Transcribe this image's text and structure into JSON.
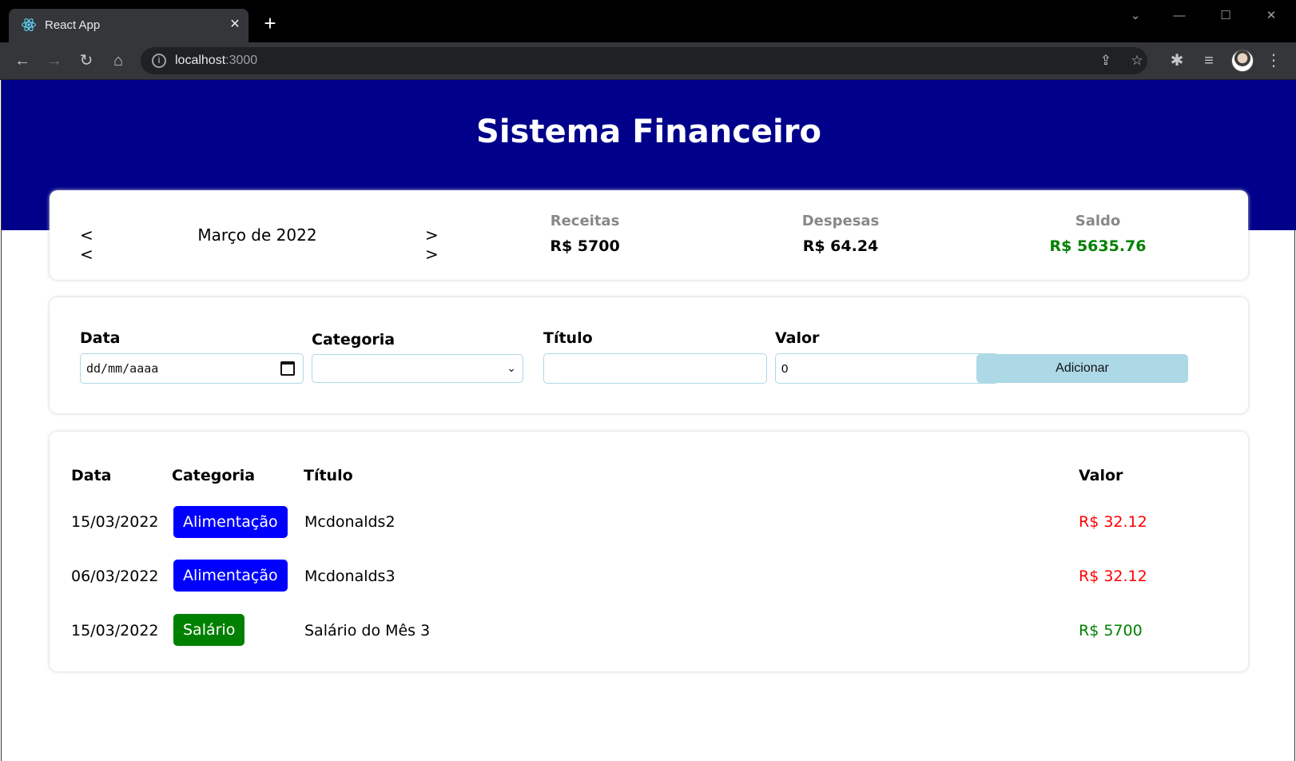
{
  "browser": {
    "tab_title": "React App",
    "url_host": "localhost",
    "url_port": ":3000"
  },
  "header": {
    "title": "Sistema Financeiro"
  },
  "info": {
    "prev_label": "< <",
    "month": "Março de 2022",
    "next_label": "> >",
    "income_title": "Receitas",
    "income_value": "R$ 5700",
    "expense_title": "Despesas",
    "expense_value": "R$ 64.24",
    "balance_title": "Saldo",
    "balance_value": "R$ 5635.76",
    "balance_color": "#008000"
  },
  "form": {
    "date_label": "Data",
    "date_placeholder": "dd/mm/aaaa",
    "category_label": "Categoria",
    "category_value": "",
    "title_label": "Título",
    "title_value": "",
    "value_label": "Valor",
    "value_value": "0",
    "add_button": "Adicionar"
  },
  "table": {
    "headers": [
      "Data",
      "Categoria",
      "Título",
      "Valor"
    ],
    "rows": [
      {
        "date": "15/03/2022",
        "category": "Alimentação",
        "category_color": "#0000ff",
        "title": "Mcdonalds2",
        "value": "R$ 32.12",
        "value_color": "#ff0000"
      },
      {
        "date": "06/03/2022",
        "category": "Alimentação",
        "category_color": "#0000ff",
        "title": "Mcdonalds3",
        "value": "R$ 32.12",
        "value_color": "#ff0000"
      },
      {
        "date": "15/03/2022",
        "category": "Salário",
        "category_color": "#008000",
        "title": "Salário do Mês 3",
        "value": "R$ 5700",
        "value_color": "#008000"
      }
    ]
  },
  "colors": {
    "header_bg": "#00008b",
    "input_border": "#add8e6",
    "button_bg": "#add8e6"
  }
}
